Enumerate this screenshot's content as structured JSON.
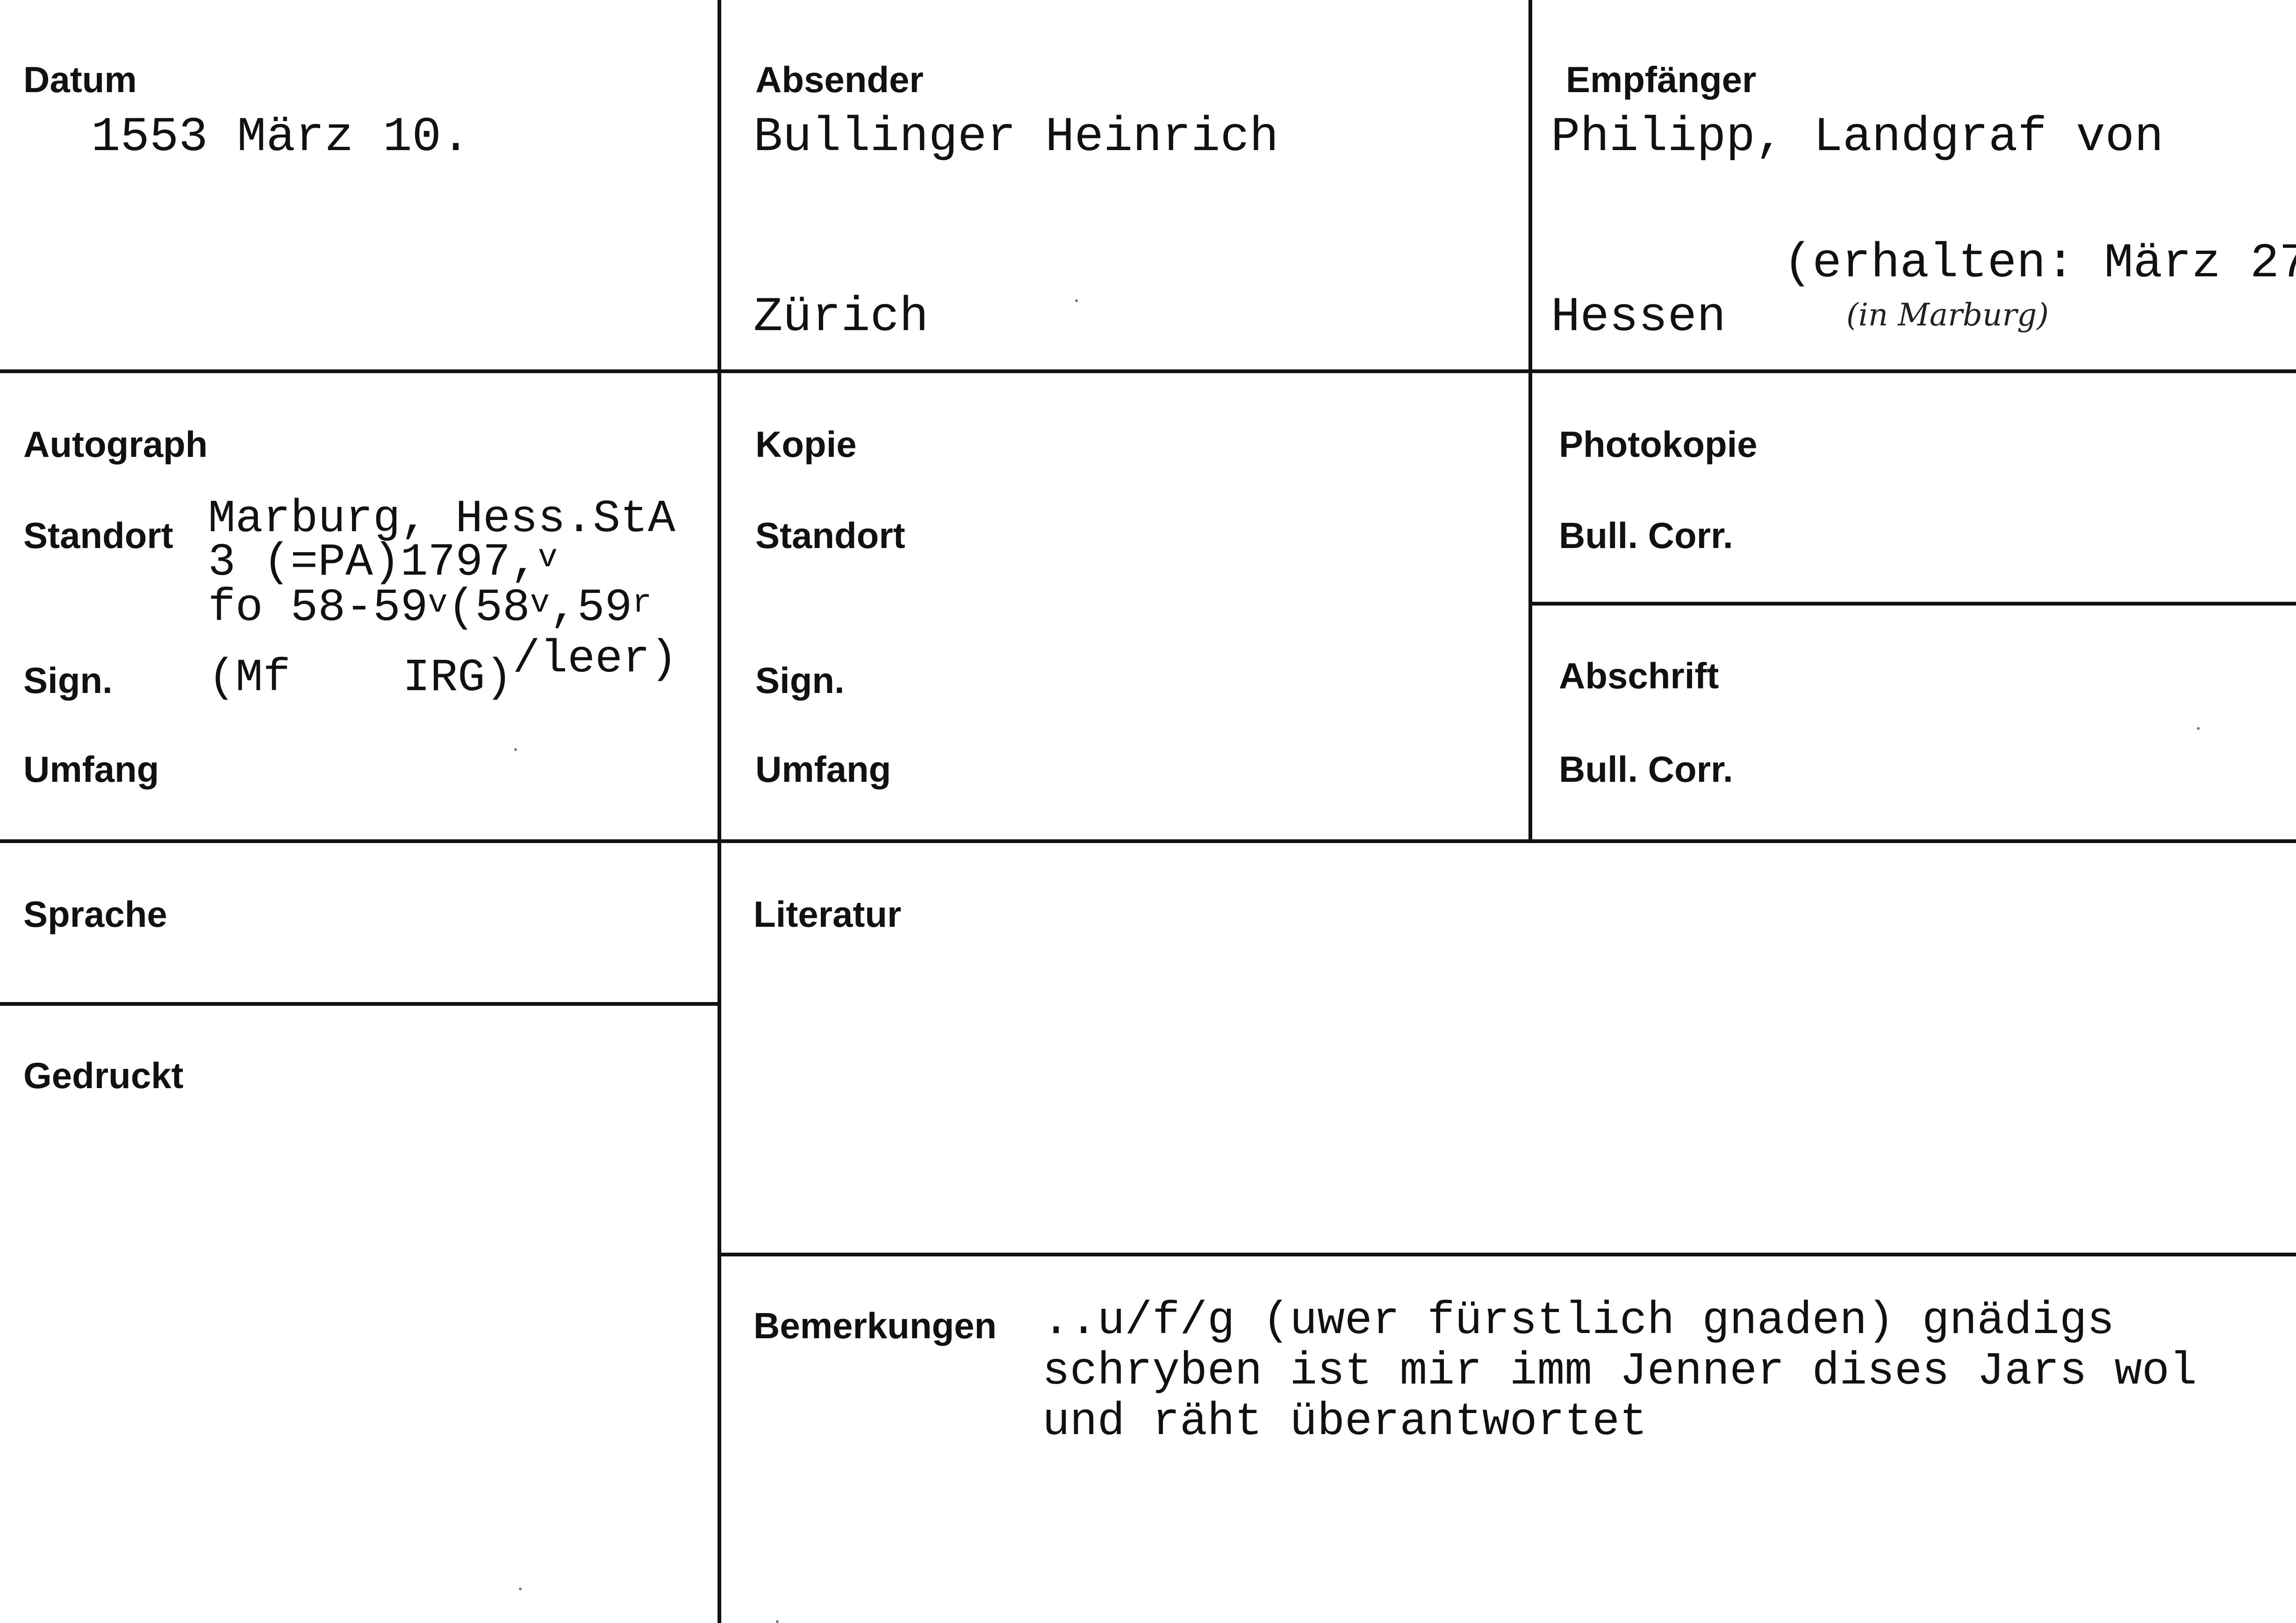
{
  "header": {
    "datum_label": "Datum",
    "datum_value": "1553 März 10.",
    "absender_label": "Absender",
    "absender_name": "Bullinger Heinrich",
    "absender_ort": "Zürich",
    "empfaenger_label": "Empfänger",
    "empfaenger_line1": "Philipp, Landgraf von",
    "empfaenger_line2": "Hessen",
    "erhalten_note": "(erhalten: März 27",
    "erhalten_handwritten": "(in Marburg)"
  },
  "autograph": {
    "label": "Autograph",
    "standort_label": "Standort",
    "standort_line1": "Marburg, Hess.StA",
    "standort_line2": "3 (=PA)1797,",
    "standort_line2_sup": "v",
    "standort_line3_a": "fo 58-59",
    "standort_line3_sup1": "v",
    "standort_line3_b": "(58",
    "standort_line3_sup2": "v",
    "standort_line3_c": ",59",
    "standort_line3_sup3": "r",
    "sign_label": "Sign.",
    "sign_value_a": "(Mf",
    "sign_value_b": "IRG)",
    "sign_value_c": "/leer)",
    "umfang_label": "Umfang"
  },
  "kopie": {
    "label": "Kopie",
    "standort_label": "Standort",
    "sign_label": "Sign.",
    "umfang_label": "Umfang"
  },
  "photokopie": {
    "label": "Photokopie",
    "value": "Bull. Corr."
  },
  "abschrift": {
    "label": "Abschrift",
    "value": "Bull. Corr."
  },
  "sprache": {
    "label": "Sprache"
  },
  "gedruckt": {
    "label": "Gedruckt"
  },
  "literatur": {
    "label": "Literatur"
  },
  "bemerkungen": {
    "label": "Bemerkungen",
    "line1": "..u/f/g (uwer fürstlich gnaden) gnädigs",
    "line2": "schryben ist mir imm Jenner dises Jars wol",
    "line3": "und räht überantwortet"
  }
}
